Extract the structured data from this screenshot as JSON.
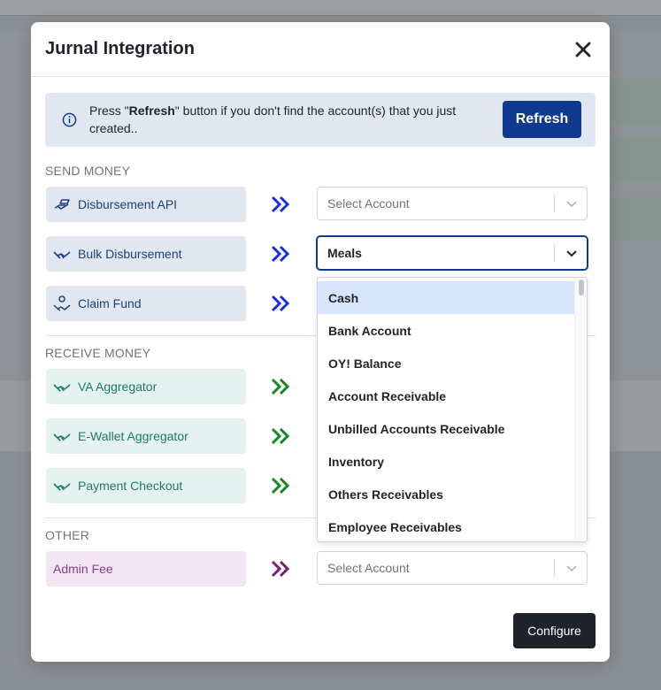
{
  "modal": {
    "title": "Jurnal Integration"
  },
  "alert": {
    "prefix": "Press \"",
    "bold": "Refresh",
    "suffix": "\" button if you don't find the account(s) that you just created..",
    "refresh_label": "Refresh"
  },
  "sections": {
    "send": "SEND MONEY",
    "receive": "RECEIVE MONEY",
    "other": "OTHER"
  },
  "send_items": [
    {
      "label": "Disbursement API",
      "icon": "hand-money-icon",
      "selected": "Select Account"
    },
    {
      "label": "Bulk Disbursement",
      "icon": "handshake-icon",
      "selected": "Meals"
    },
    {
      "label": "Claim Fund",
      "icon": "hand-coin-icon",
      "selected": ""
    }
  ],
  "receive_items": [
    {
      "label": "VA Aggregator",
      "icon": "handshake-icon"
    },
    {
      "label": "E-Wallet Aggregator",
      "icon": "handshake-icon"
    },
    {
      "label": "Payment Checkout",
      "icon": "handshake-icon"
    }
  ],
  "other_items": [
    {
      "label": "Admin Fee",
      "selected": "Select Account"
    }
  ],
  "dropdown": {
    "options": [
      "Cash",
      "Bank Account",
      "OY! Balance",
      "Account Receivable",
      "Unbilled Accounts Receivable",
      "Inventory",
      "Others Receivables",
      "Employee Receivables"
    ],
    "highlighted": "Cash"
  },
  "footer": {
    "configure_label": "Configure"
  },
  "colors": {
    "send_arrow": "#1a2fe0",
    "receive_arrow": "#0f8a1c",
    "other_arrow": "#7a1a7a",
    "primary": "#103a8f"
  }
}
